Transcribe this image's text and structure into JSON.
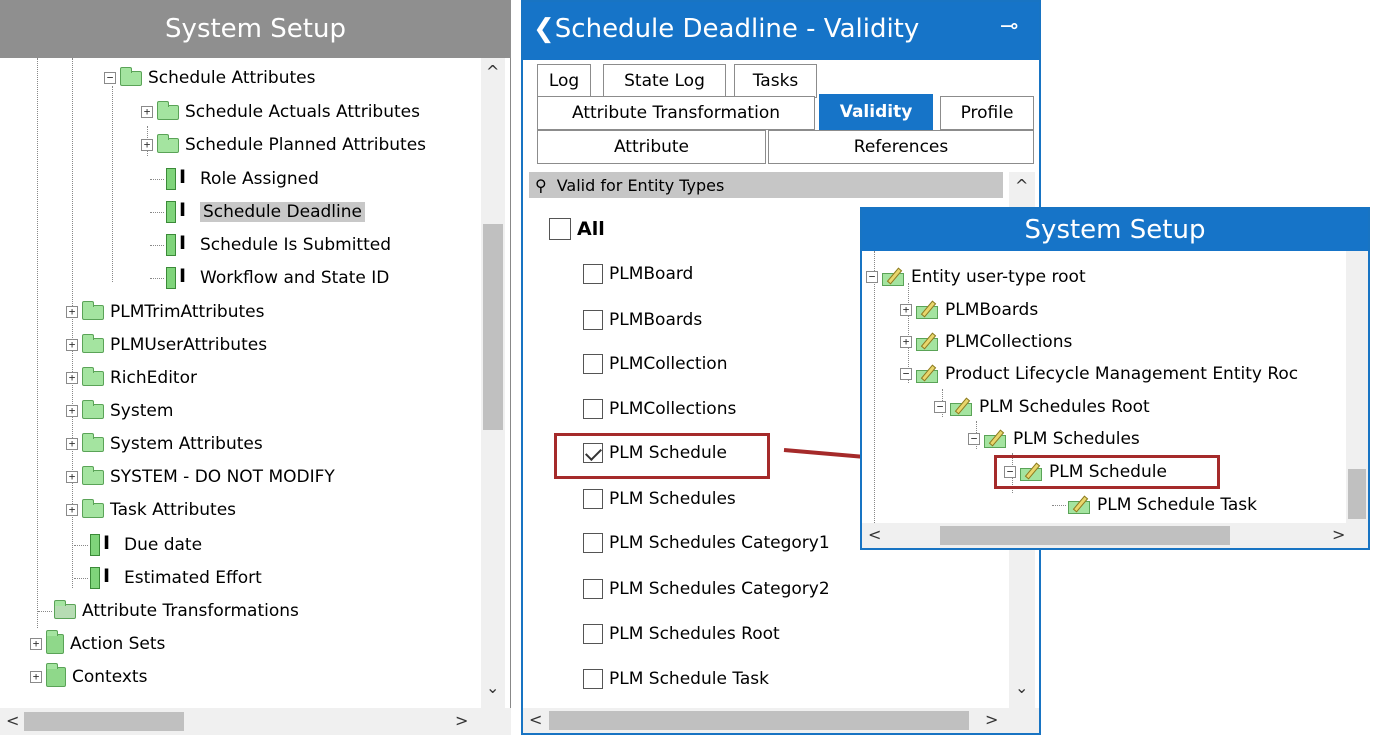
{
  "left_panel": {
    "title": "System Setup",
    "items": [
      {
        "label": "Schedule Attributes"
      },
      {
        "label": "Schedule Actuals Attributes"
      },
      {
        "label": "Schedule Planned Attributes"
      },
      {
        "label": "Role Assigned"
      },
      {
        "label": "Schedule Deadline"
      },
      {
        "label": "Schedule Is Submitted"
      },
      {
        "label": "Workflow and State ID"
      },
      {
        "label": "PLMTrimAttributes"
      },
      {
        "label": "PLMUserAttributes"
      },
      {
        "label": "RichEditor"
      },
      {
        "label": "System"
      },
      {
        "label": "System Attributes"
      },
      {
        "label": "SYSTEM - DO NOT MODIFY"
      },
      {
        "label": "Task Attributes"
      },
      {
        "label": "Due date"
      },
      {
        "label": "Estimated Effort"
      },
      {
        "label": "Attribute Transformations"
      },
      {
        "label": "Action Sets"
      },
      {
        "label": "Contexts"
      }
    ],
    "selected": "Schedule Deadline"
  },
  "middle_panel": {
    "title": "❮Schedule Deadline - Validity",
    "pin_icon": "pin-icon",
    "tabs_row1": [
      "Log",
      "State Log",
      "Tasks"
    ],
    "tabs_row2": [
      "Attribute Transformation",
      "Validity",
      "Profile"
    ],
    "tabs_row3": [
      "Attribute",
      "References"
    ],
    "active_tab": "Validity",
    "section_label": "Valid for Entity Types",
    "all_label": "All",
    "entity_types": [
      {
        "label": "PLMBoard",
        "checked": false
      },
      {
        "label": "PLMBoards",
        "checked": false
      },
      {
        "label": "PLMCollection",
        "checked": false
      },
      {
        "label": "PLMCollections",
        "checked": false
      },
      {
        "label": "PLM Schedule",
        "checked": true
      },
      {
        "label": "PLM Schedules",
        "checked": false
      },
      {
        "label": "PLM Schedules Category1",
        "checked": false
      },
      {
        "label": "PLM Schedules Category2",
        "checked": false
      },
      {
        "label": "PLM Schedules Root",
        "checked": false
      },
      {
        "label": "PLM Schedule Task",
        "checked": false
      }
    ]
  },
  "popup_panel": {
    "title": "System Setup",
    "items": [
      {
        "label": "Entity user-type root"
      },
      {
        "label": "PLMBoards"
      },
      {
        "label": "PLMCollections"
      },
      {
        "label": "Product Lifecycle Management Entity Roc"
      },
      {
        "label": "PLM Schedules Root"
      },
      {
        "label": "PLM Schedules"
      },
      {
        "label": "PLM Schedule"
      },
      {
        "label": "PLM Schedule Task"
      }
    ]
  },
  "colors": {
    "accent_blue": "#1674c8",
    "highlight_red": "#a52a2a",
    "folder_green": "#a4e4a0"
  }
}
